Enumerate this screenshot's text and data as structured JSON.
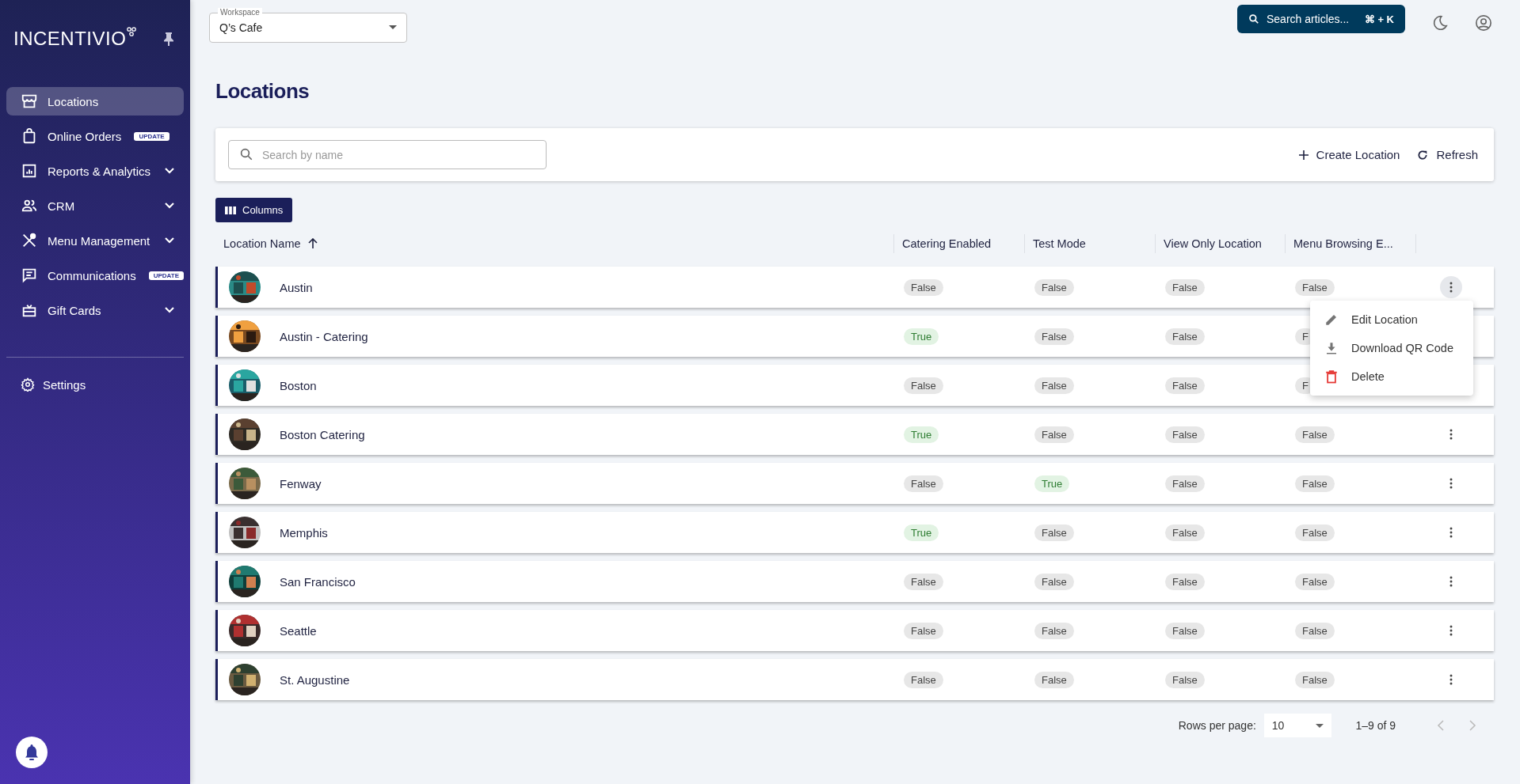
{
  "sidebar": {
    "logo": "INCENTIVIO",
    "items": [
      {
        "label": "Locations",
        "selected": true,
        "expandable": false
      },
      {
        "label": "Online Orders",
        "badge": "UPDATE",
        "selected": false,
        "expandable": false
      },
      {
        "label": "Reports & Analytics",
        "selected": false,
        "expandable": true
      },
      {
        "label": "CRM",
        "selected": false,
        "expandable": true
      },
      {
        "label": "Menu Management",
        "selected": false,
        "expandable": true
      },
      {
        "label": "Communications",
        "badge": "UPDATE",
        "selected": false,
        "expandable": false
      },
      {
        "label": "Gift Cards",
        "selected": false,
        "expandable": true
      }
    ],
    "settings": "Settings"
  },
  "workspace": {
    "label": "Workspace",
    "value": "Q’s Cafe"
  },
  "help_search": {
    "label": "Search articles...",
    "shortcut": "⌘ + K"
  },
  "page_title": "Locations",
  "toolbar": {
    "search_placeholder": "Search by name",
    "buttons": [
      "Create Location",
      "Refresh"
    ]
  },
  "columns_button": "Columns",
  "table": {
    "columns": [
      {
        "label": "Location Name",
        "sorted": true
      },
      {
        "label": "Catering Enabled",
        "sorted": false
      },
      {
        "label": "Test Mode",
        "sorted": false
      },
      {
        "label": "View Only Location",
        "sorted": false
      },
      {
        "label": "Menu Browsing E...",
        "sorted": false
      }
    ],
    "rows": [
      {
        "menu_open": true,
        "cells": [
          {
            "text": "Austin"
          },
          {
            "text": "False",
            "on": false
          },
          {
            "text": "False",
            "on": false
          },
          {
            "text": "False",
            "on": false
          },
          {
            "text": "False",
            "on": false
          }
        ]
      },
      {
        "cells": [
          {
            "text": "Austin - Catering"
          },
          {
            "text": "True",
            "on": true
          },
          {
            "text": "False",
            "on": false
          },
          {
            "text": "False",
            "on": false
          },
          {
            "text": "F",
            "on": false
          }
        ]
      },
      {
        "cells": [
          {
            "text": "Boston"
          },
          {
            "text": "False",
            "on": false
          },
          {
            "text": "False",
            "on": false
          },
          {
            "text": "False",
            "on": false
          },
          {
            "text": "F",
            "on": false
          }
        ]
      },
      {
        "menu_open": false,
        "cells": [
          {
            "text": "Boston Catering"
          },
          {
            "text": "True",
            "on": true
          },
          {
            "text": "False",
            "on": false
          },
          {
            "text": "False",
            "on": false
          },
          {
            "text": "False",
            "on": false
          }
        ]
      },
      {
        "menu_open": false,
        "cells": [
          {
            "text": "Fenway"
          },
          {
            "text": "False",
            "on": false
          },
          {
            "text": "True",
            "on": true
          },
          {
            "text": "False",
            "on": false
          },
          {
            "text": "False",
            "on": false
          }
        ]
      },
      {
        "menu_open": false,
        "cells": [
          {
            "text": "Memphis"
          },
          {
            "text": "True",
            "on": true
          },
          {
            "text": "False",
            "on": false
          },
          {
            "text": "False",
            "on": false
          },
          {
            "text": "False",
            "on": false
          }
        ]
      },
      {
        "menu_open": false,
        "cells": [
          {
            "text": "San Francisco"
          },
          {
            "text": "False",
            "on": false
          },
          {
            "text": "False",
            "on": false
          },
          {
            "text": "False",
            "on": false
          },
          {
            "text": "False",
            "on": false
          }
        ]
      },
      {
        "menu_open": false,
        "cells": [
          {
            "text": "Seattle"
          },
          {
            "text": "False",
            "on": false
          },
          {
            "text": "False",
            "on": false
          },
          {
            "text": "False",
            "on": false
          },
          {
            "text": "False",
            "on": false
          }
        ]
      },
      {
        "menu_open": false,
        "cells": [
          {
            "text": "St. Augustine"
          },
          {
            "text": "False",
            "on": false
          },
          {
            "text": "False",
            "on": false
          },
          {
            "text": "False",
            "on": false
          },
          {
            "text": "False",
            "on": false
          }
        ]
      }
    ]
  },
  "row_menu": {
    "items": [
      {
        "label": "Edit Location",
        "danger": false
      },
      {
        "label": "Download QR Code",
        "danger": false
      },
      {
        "label": "Delete",
        "danger": true
      }
    ]
  },
  "pagination": {
    "label": "Rows per page:",
    "per_page": "10",
    "range": "1–9 of 9"
  }
}
